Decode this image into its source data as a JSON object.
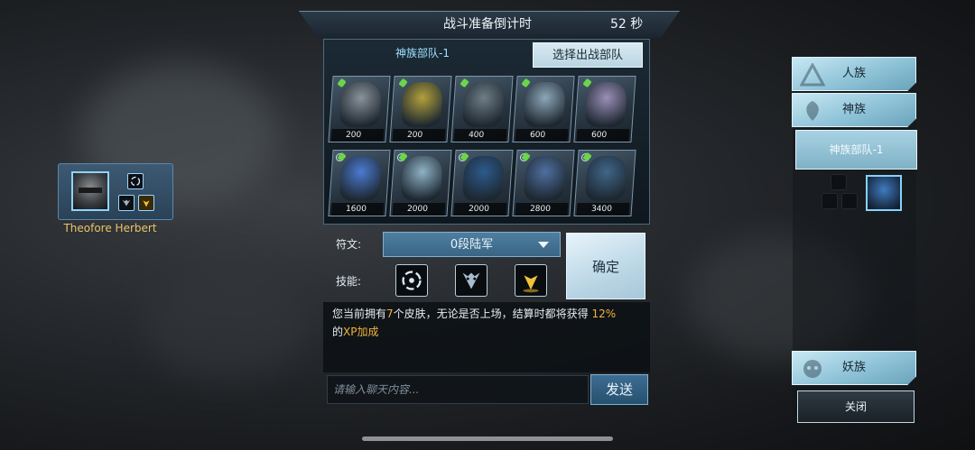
{
  "player": {
    "name": "Theofore Herbert",
    "skills": [
      "vortex-icon",
      "demon-mask-icon",
      "golden-arrow-icon"
    ]
  },
  "header": {
    "title": "战斗准备倒计时",
    "timer": "52 秒"
  },
  "team": {
    "tab_label": "神族部队-1",
    "select_button": "选择出战部队"
  },
  "units": [
    {
      "icon": "armored-knight-icon",
      "cost": "200",
      "color": "#8a929a"
    },
    {
      "icon": "golden-mech-icon",
      "cost": "200",
      "color": "#b3a13c"
    },
    {
      "icon": "steel-titan-icon",
      "cost": "400",
      "color": "#6f7d86"
    },
    {
      "icon": "blade-drone-icon",
      "cost": "600",
      "color": "#8da7b8"
    },
    {
      "icon": "crystal-seer-icon",
      "cost": "600",
      "color": "#9a8fb7"
    },
    {
      "icon": "shield-warden-icon",
      "cost": "1600",
      "color": "#4b7bd1"
    },
    {
      "icon": "ascendant-icon",
      "cost": "2000",
      "color": "#8fb2c6"
    },
    {
      "icon": "dark-templar-icon",
      "cost": "2000",
      "color": "#2c5a8c"
    },
    {
      "icon": "void-stalker-icon",
      "cost": "2800",
      "color": "#4f6fa0"
    },
    {
      "icon": "carrier-ship-icon",
      "cost": "3400",
      "color": "#3f6689"
    }
  ],
  "rune": {
    "label": "符文:",
    "value": "0段陆军"
  },
  "skills": {
    "label": "技能:",
    "items": [
      "vortex-icon",
      "demon-mask-icon",
      "golden-arrow-icon"
    ]
  },
  "confirm_button": "确定",
  "info": {
    "part1": "您当前拥有",
    "count": "7",
    "part2": "个皮肤，无论是否上场，结算时都将获得 ",
    "percent": "12%",
    "part3": "的",
    "xp": "XP加成"
  },
  "chat": {
    "placeholder": "请输入聊天内容...",
    "send_button": "发送"
  },
  "sidebar": {
    "races": [
      "人族",
      "神族"
    ],
    "team_item": "神族部队-1",
    "demon_race": "妖族",
    "close_button": "关闭"
  }
}
